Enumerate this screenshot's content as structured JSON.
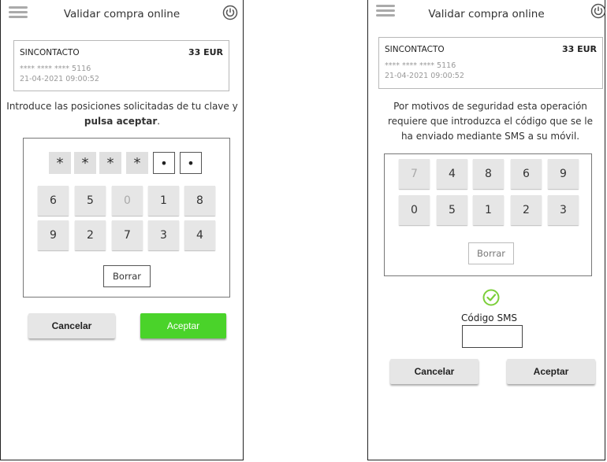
{
  "left_screen": {
    "header": {
      "title": "Validar compra online",
      "menu_icon": "hamburger-menu-icon",
      "power_icon": "power-icon"
    },
    "transaction": {
      "merchant": "SINCONTACTO",
      "amount": "33 EUR",
      "card": "**** **** **** 5116",
      "date": "21-04-2021 09:00:52"
    },
    "instruction_part1": "Introduce las posiciones solicitadas de tu clave y ",
    "instruction_bold": "pulsa aceptar",
    "instruction_end": ".",
    "pin_slots": [
      "*",
      "*",
      "*",
      "*",
      "•",
      "•"
    ],
    "keys_row1": [
      "6",
      "5",
      "0",
      "1",
      "8"
    ],
    "keys_row2": [
      "9",
      "2",
      "7",
      "3",
      "4"
    ],
    "clear_label": "Borrar",
    "cancel_label": "Cancelar",
    "accept_label": "Aceptar",
    "colors": {
      "accept": "#4ad32a",
      "key_bg": "#e6e6e6"
    }
  },
  "right_screen": {
    "header": {
      "title": "Validar compra online",
      "menu_icon": "hamburger-menu-icon",
      "power_icon": "power-icon"
    },
    "transaction": {
      "merchant": "SINCONTACTO",
      "amount": "33 EUR",
      "card": "**** **** **** 5116",
      "date": "21-04-2021 09:00:52"
    },
    "instruction": "Por motivos de seguridad esta operación requiere que introduzca el código que se le ha enviado mediante SMS a su móvil.",
    "keys_row1": [
      "7",
      "4",
      "8",
      "6",
      "9"
    ],
    "keys_row2": [
      "0",
      "5",
      "1",
      "2",
      "3"
    ],
    "clear_label": "Borrar",
    "check_icon": "check-circle-icon",
    "sms_label": "Código SMS",
    "sms_value": "",
    "cancel_label": "Cancelar",
    "accept_label": "Aceptar",
    "colors": {
      "check": "#7ccf3a"
    }
  }
}
